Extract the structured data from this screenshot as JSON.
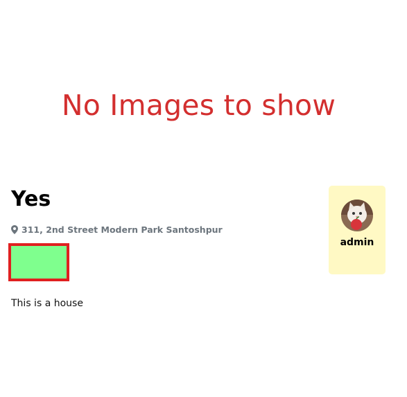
{
  "gallery": {
    "empty_message": "No Images to show"
  },
  "listing": {
    "title": "Yes",
    "address": "311, 2nd Street Modern Park Santoshpur",
    "description": "This is a house",
    "tag_color": "#7fff8e",
    "tag_border_color": "#e02020"
  },
  "owner": {
    "username": "admin",
    "card_color": "#fff9c4"
  },
  "icons": {
    "address": "map-pin-icon"
  },
  "colors": {
    "empty_message": "#d32f2f",
    "address_text": "#6c757d"
  }
}
